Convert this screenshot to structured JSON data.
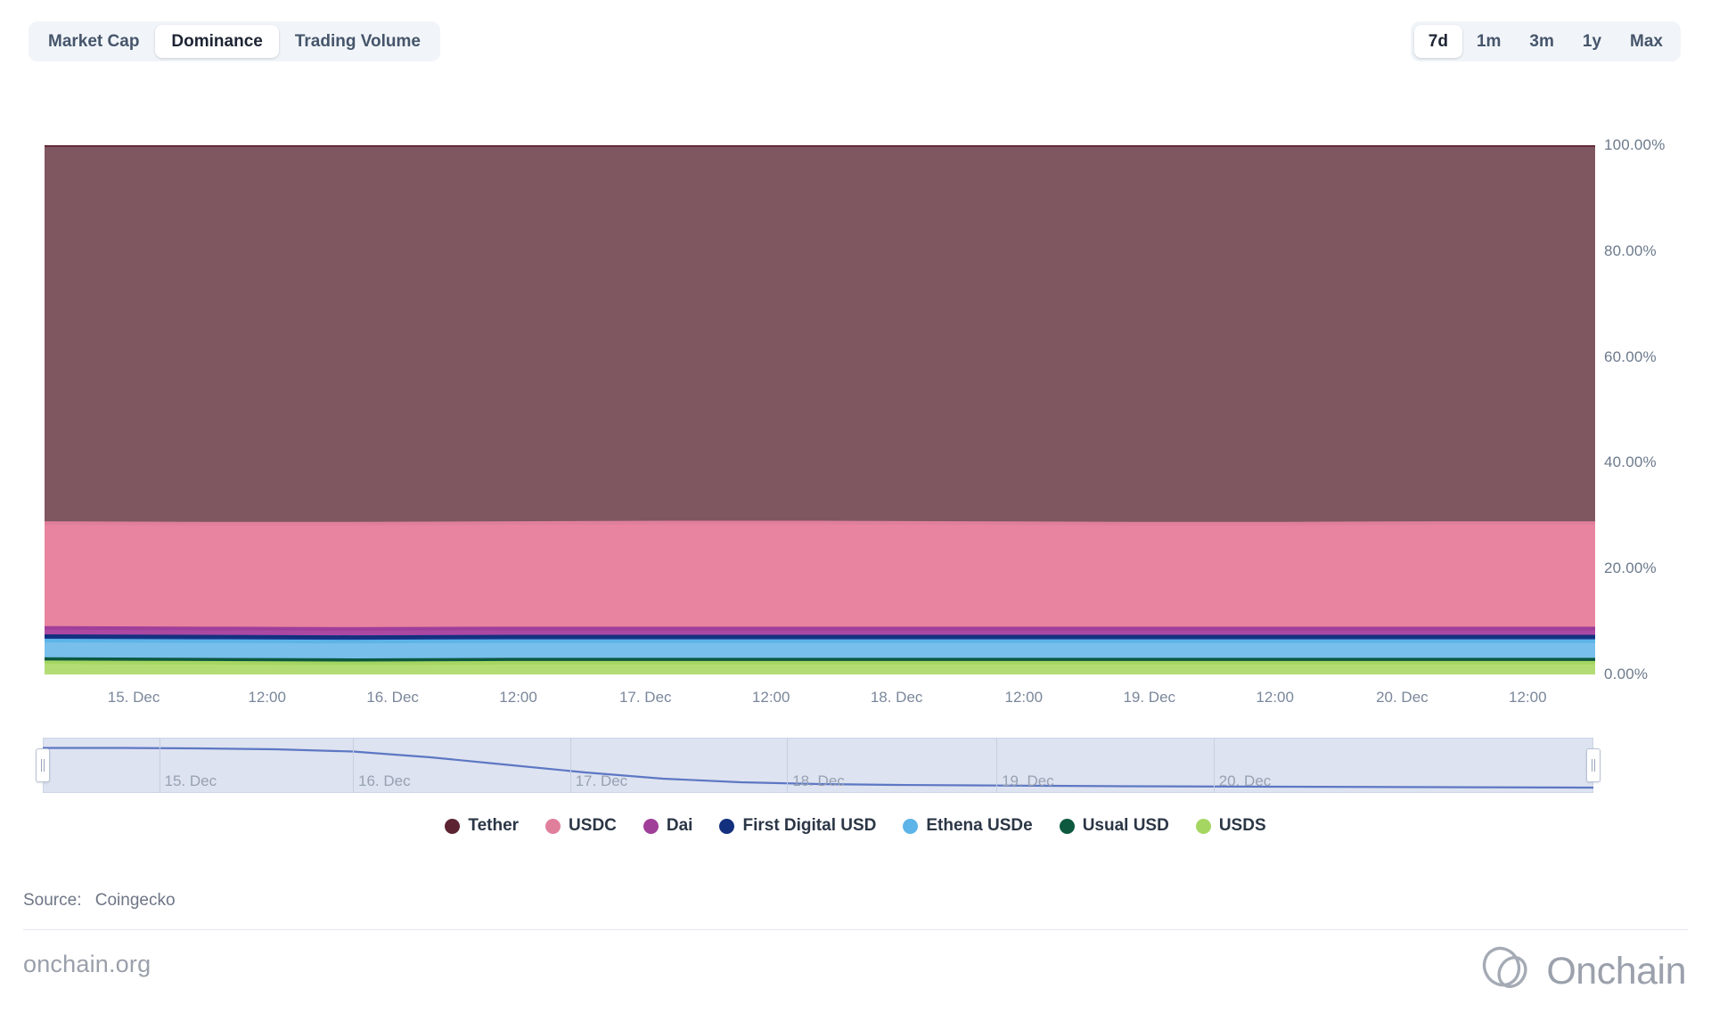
{
  "toolbar": {
    "metric_tabs": [
      {
        "label": "Market Cap",
        "active": false
      },
      {
        "label": "Dominance",
        "active": true
      },
      {
        "label": "Trading Volume",
        "active": false
      }
    ],
    "range_tabs": [
      {
        "label": "7d",
        "active": true
      },
      {
        "label": "1m",
        "active": false
      },
      {
        "label": "3m",
        "active": false
      },
      {
        "label": "1y",
        "active": false
      },
      {
        "label": "Max",
        "active": false
      }
    ]
  },
  "source": {
    "label": "Source:",
    "value": "Coingecko"
  },
  "footer": {
    "site": "onchain.org",
    "logo_text": "Onchain",
    "logo_icon": "onchain-knot-logo"
  },
  "navigator": {
    "labels": [
      "15. Dec",
      "16. Dec",
      "17. Dec",
      "18. Dec",
      "19. Dec",
      "20. Dec"
    ],
    "label_positions": [
      0.075,
      0.2,
      0.34,
      0.48,
      0.615,
      0.755
    ],
    "series_values": [
      0.93,
      0.93,
      0.92,
      0.9,
      0.85,
      0.72,
      0.55,
      0.38,
      0.24,
      0.16,
      0.12,
      0.1,
      0.09,
      0.08,
      0.07,
      0.065,
      0.06,
      0.055,
      0.05,
      0.045,
      0.04
    ],
    "handle_left": "drag-handle-left",
    "handle_right": "drag-handle-right"
  },
  "chart_data": {
    "type": "area",
    "stacked": true,
    "title": "",
    "xlabel": "",
    "ylabel": "",
    "ylim": [
      0,
      100
    ],
    "grid": false,
    "legend_position": "bottom",
    "y_ticks": [
      "0.00%",
      "20.00%",
      "40.00%",
      "60.00%",
      "80.00%",
      "100.00%"
    ],
    "y_tick_values": [
      0,
      20,
      40,
      60,
      80,
      100
    ],
    "x_ticks": [
      "15. Dec",
      "12:00",
      "16. Dec",
      "12:00",
      "17. Dec",
      "12:00",
      "18. Dec",
      "12:00",
      "19. Dec",
      "12:00",
      "20. Dec",
      "12:00"
    ],
    "x_tick_positions": [
      0.0575,
      0.1435,
      0.2245,
      0.3055,
      0.3875,
      0.4685,
      0.5495,
      0.6315,
      0.7125,
      0.7935,
      0.8755,
      0.9565
    ],
    "x": [
      0,
      0.1,
      0.2,
      0.3,
      0.4,
      0.5,
      0.6,
      0.7,
      0.8,
      0.9,
      1.0
    ],
    "series": [
      {
        "name": "Tether",
        "color": "#5c2433",
        "fill": "#7f5760",
        "values": [
          71.4,
          71.5,
          71.5,
          71.4,
          71.3,
          71.3,
          71.4,
          71.5,
          71.5,
          71.4,
          71.4
        ]
      },
      {
        "name": "USDC",
        "color": "#e07f9c",
        "fill": "#e8849f",
        "values": [
          19.8,
          19.8,
          19.9,
          19.9,
          20.0,
          20.0,
          19.9,
          19.8,
          19.8,
          19.9,
          19.9
        ]
      },
      {
        "name": "Dai",
        "color": "#a03f9a",
        "fill": "#ab48a2",
        "values": [
          1.55,
          1.55,
          1.55,
          1.55,
          1.55,
          1.55,
          1.55,
          1.55,
          1.55,
          1.55,
          1.55
        ]
      },
      {
        "name": "First Digital USD",
        "color": "#13307f",
        "fill": "#1c3f96",
        "values": [
          0.85,
          0.85,
          0.85,
          0.85,
          0.85,
          0.85,
          0.85,
          0.85,
          0.85,
          0.85,
          0.85
        ]
      },
      {
        "name": "Ethena USDe",
        "color": "#5db4e8",
        "fill": "#78bfeb",
        "values": [
          3.5,
          3.5,
          3.5,
          3.5,
          3.5,
          3.5,
          3.5,
          3.5,
          3.5,
          3.5,
          3.5
        ]
      },
      {
        "name": "Usual USD",
        "color": "#0c5940",
        "fill": "#10654a",
        "values": [
          0.6,
          0.6,
          0.6,
          0.6,
          0.6,
          0.6,
          0.6,
          0.6,
          0.6,
          0.6,
          0.6
        ]
      },
      {
        "name": "USDS",
        "color": "#a6d662",
        "fill": "#b3dd74",
        "values": [
          2.3,
          2.3,
          2.25,
          2.3,
          2.3,
          2.3,
          2.3,
          2.3,
          2.25,
          2.3,
          2.3
        ]
      }
    ]
  }
}
